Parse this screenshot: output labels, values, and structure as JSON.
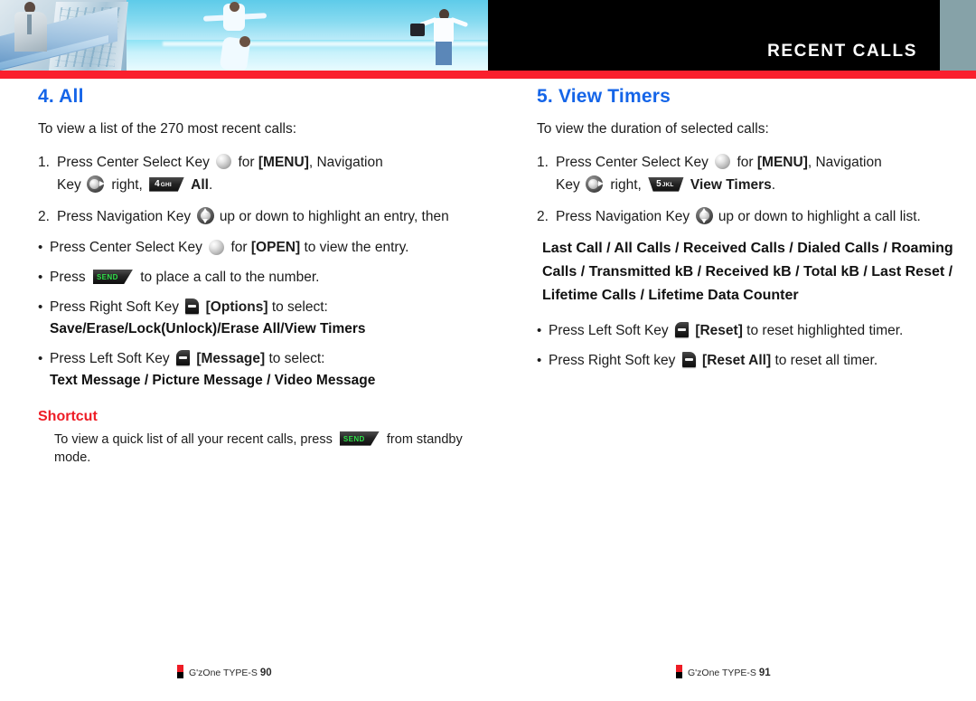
{
  "header": {
    "title": "RECENT CALLS",
    "accent_red": "#fa1f2d",
    "gray_bar": "#86a2a8",
    "black": "#000000"
  },
  "colors": {
    "heading_blue": "#1565e8",
    "shortcut_red": "#ee1c25",
    "body_text": "#1c1c1c",
    "send_green": "#31e04a"
  },
  "left": {
    "title": "4. All",
    "intro": "To view a list of the 270 most recent calls:",
    "step1": {
      "a": "Press Center Select Key",
      "b": "for",
      "menu": "[MENU]",
      "c": ", Navigation",
      "key_label": "Key",
      "d": "right,",
      "numkey_digit": "4",
      "numkey_letters": "GHI",
      "target": "All",
      "period": "."
    },
    "step2": {
      "a": "Press Navigation Key",
      "b": "up or down to highlight an entry, then"
    },
    "bullets": [
      {
        "a": "Press Center Select Key",
        "b": "for",
        "open": "[OPEN]",
        "c": "to view the entry."
      },
      {
        "a": "Press",
        "send_label": "SEND",
        "c": "to place a call to the number."
      },
      {
        "a": "Press Right Soft Key",
        "options": "[Options]",
        "c": "to select:",
        "bold_line": "Save/Erase/Lock(Unlock)/Erase All/View Timers"
      },
      {
        "a": "Press Left Soft Key",
        "message": "[Message]",
        "c": "to select:",
        "bold_line": "Text Message / Picture Message / Video Message"
      }
    ],
    "shortcut": {
      "heading": "Shortcut",
      "text_before": "To view a quick list of all your recent calls, press",
      "send_label": "SEND",
      "text_after": "from standby mode."
    }
  },
  "right": {
    "title": "5. View Timers",
    "intro": "To view the duration of selected calls:",
    "step1": {
      "a": "Press Center Select Key",
      "b": "for",
      "menu": "[MENU]",
      "c": ", Navigation",
      "key_label": "Key",
      "d": "right,",
      "numkey_digit": "5",
      "numkey_letters": "JKL",
      "target": "View Timers",
      "period": "."
    },
    "step2": {
      "a": "Press Navigation Key",
      "b": "up or down to highlight a call list."
    },
    "call_lists": "Last Call / All Calls / Received Calls / Dialed Calls / Roaming Calls / Transmitted kB / Received kB / Total kB / Last Reset / Lifetime Calls / Lifetime Data Counter",
    "bullets": [
      {
        "a": "Press Left Soft Key",
        "action": "[Reset]",
        "c": "to reset highlighted timer."
      },
      {
        "a": "Press Right Soft key",
        "action": "[Reset All]",
        "c": "to reset all timer."
      }
    ]
  },
  "footer": {
    "left_brand": "G'zOne TYPE-S",
    "left_page": "90",
    "right_brand": "G'zOne TYPE-S",
    "right_page": "91"
  }
}
